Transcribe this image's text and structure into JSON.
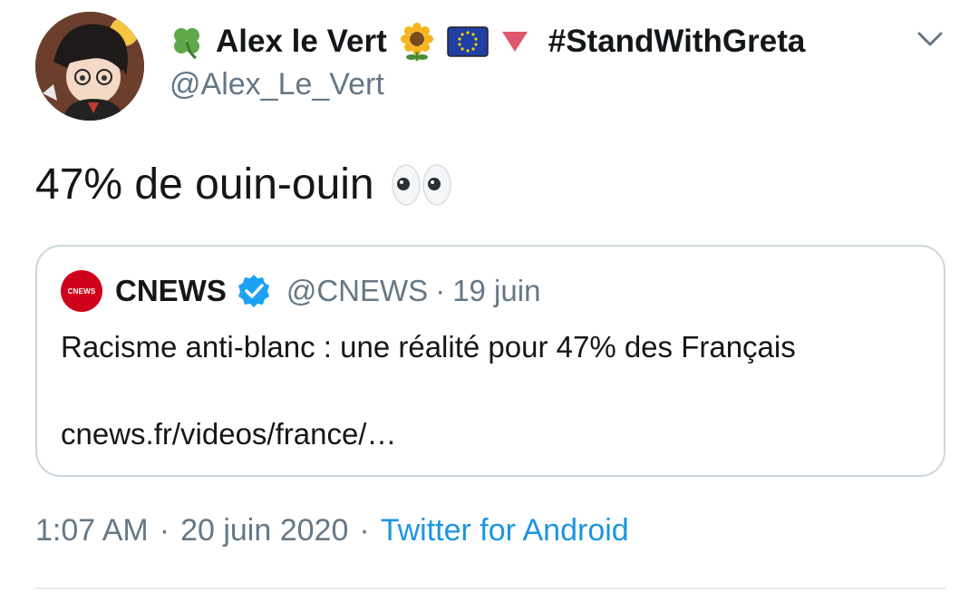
{
  "author": {
    "display_name": "Alex le Vert",
    "name_emojis": [
      "shamrock-icon",
      "sunflower-icon",
      "eu-flag-icon",
      "red-triangle-icon"
    ],
    "hashtag": "#StandWithGreta",
    "handle": "@Alex_Le_Vert",
    "avatar_icon": "anime-avatar"
  },
  "tweet": {
    "text": "47% de ouin-ouin",
    "trailing_emoji": "eyes-icon"
  },
  "quoted_tweet": {
    "avatar_label": "CNEWS",
    "name": "CNEWS",
    "verified": true,
    "handle": "@CNEWS",
    "separator": "·",
    "date": "19 juin",
    "text": "Racisme anti-blanc : une réalité pour 47% des Français",
    "link": "cnews.fr/videos/france/…"
  },
  "meta": {
    "time": "1:07 AM",
    "separator": "·",
    "date": "20 juin 2020",
    "source": "Twitter for Android"
  },
  "colors": {
    "text": "#14171a",
    "secondary": "#657786",
    "link": "#1b95e0",
    "border": "#ccd6dd",
    "verified": "#1da1f2",
    "cnews_red": "#d0021b"
  }
}
